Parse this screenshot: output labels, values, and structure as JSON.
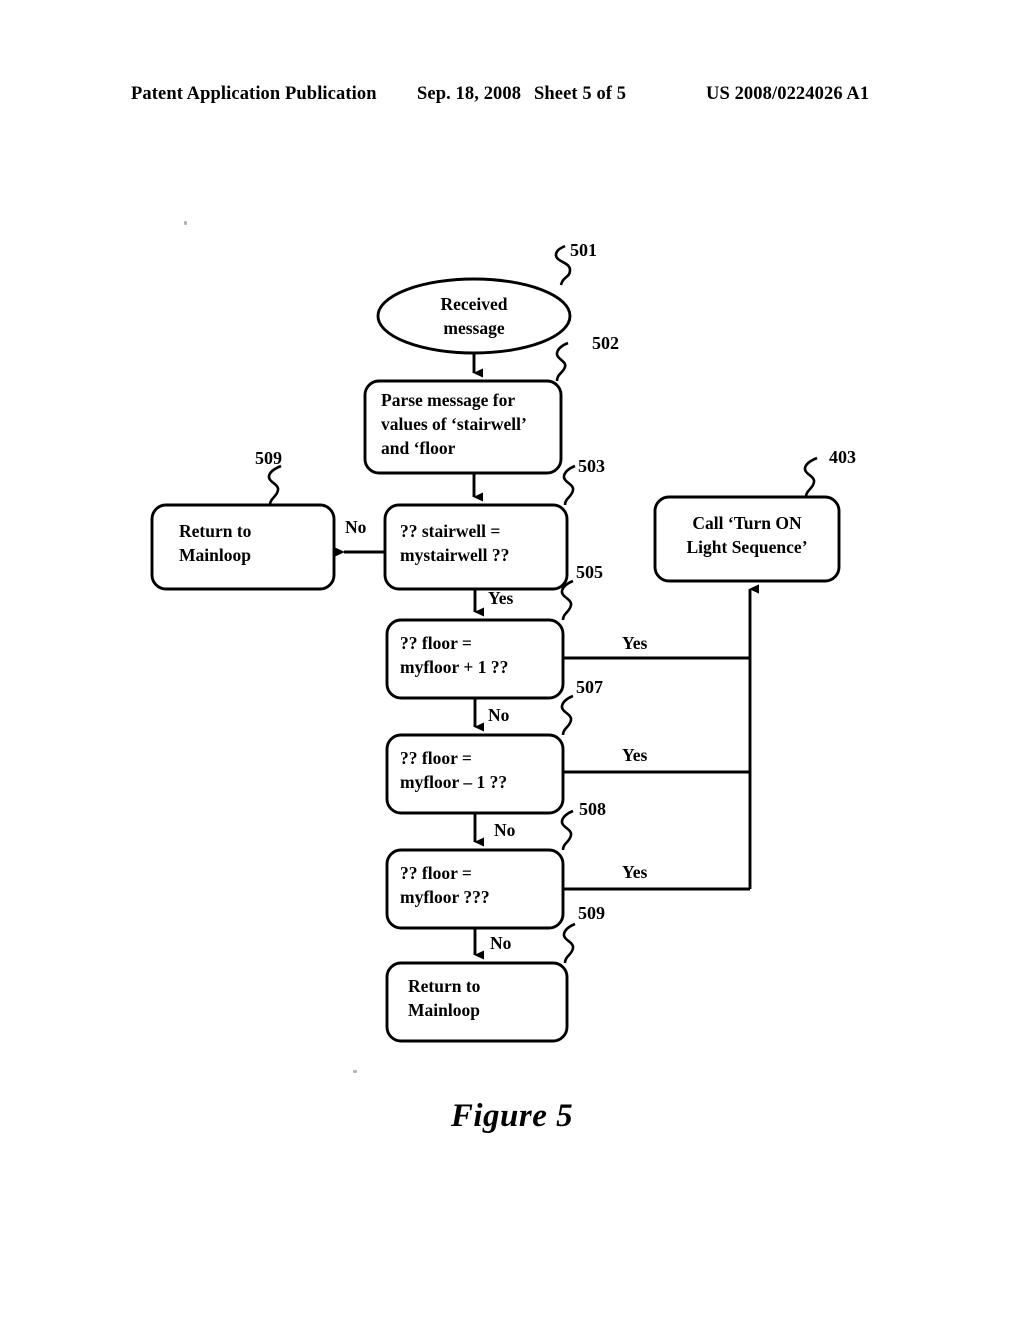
{
  "header": {
    "publication": "Patent Application Publication",
    "date": "Sep. 18, 2008",
    "sheet": "Sheet 5 of 5",
    "patent_number": "US 2008/0224026 A1"
  },
  "figure": {
    "caption": "Figure 5",
    "nodes": [
      {
        "id": "start",
        "shape": "ellipse",
        "text": "Received\nmessage"
      },
      {
        "id": "parse",
        "shape": "rounded-rect",
        "text": "Parse message for\nvalues of ‘stairwell’\nand ‘floor"
      },
      {
        "id": "return-top",
        "shape": "rounded-rect",
        "text": "Return to\nMainloop"
      },
      {
        "id": "stairwell",
        "shape": "rounded-rect",
        "text": "?? stairwell =\nmystairwell ??"
      },
      {
        "id": "call-on",
        "shape": "rounded-rect",
        "text": "Call ‘Turn ON\nLight Sequence’"
      },
      {
        "id": "floor-plus",
        "shape": "rounded-rect",
        "text": "?? floor =\nmyfloor + 1 ??"
      },
      {
        "id": "floor-minus",
        "shape": "rounded-rect",
        "text": "??  floor =\nmyfloor – 1  ??"
      },
      {
        "id": "floor-equal",
        "shape": "rounded-rect",
        "text": "??  floor =\nmyfloor   ???"
      },
      {
        "id": "return-bottom",
        "shape": "rounded-rect",
        "text": "Return to\nMainloop"
      }
    ],
    "edge_labels": {
      "stairwell_no": "No",
      "stairwell_yes": "Yes",
      "floor_plus_yes": "Yes",
      "floor_plus_no": "No",
      "floor_minus_yes": "Yes",
      "floor_minus_no": "No",
      "floor_equal_yes": "Yes",
      "floor_equal_no": "No"
    },
    "reference_numerals": {
      "start": "501",
      "parse": "502",
      "stairwell": "503",
      "return_top": "509",
      "call_on": "403",
      "floor_plus": "505",
      "floor_minus": "507",
      "floor_equal": "508",
      "return_bottom": "509"
    }
  }
}
